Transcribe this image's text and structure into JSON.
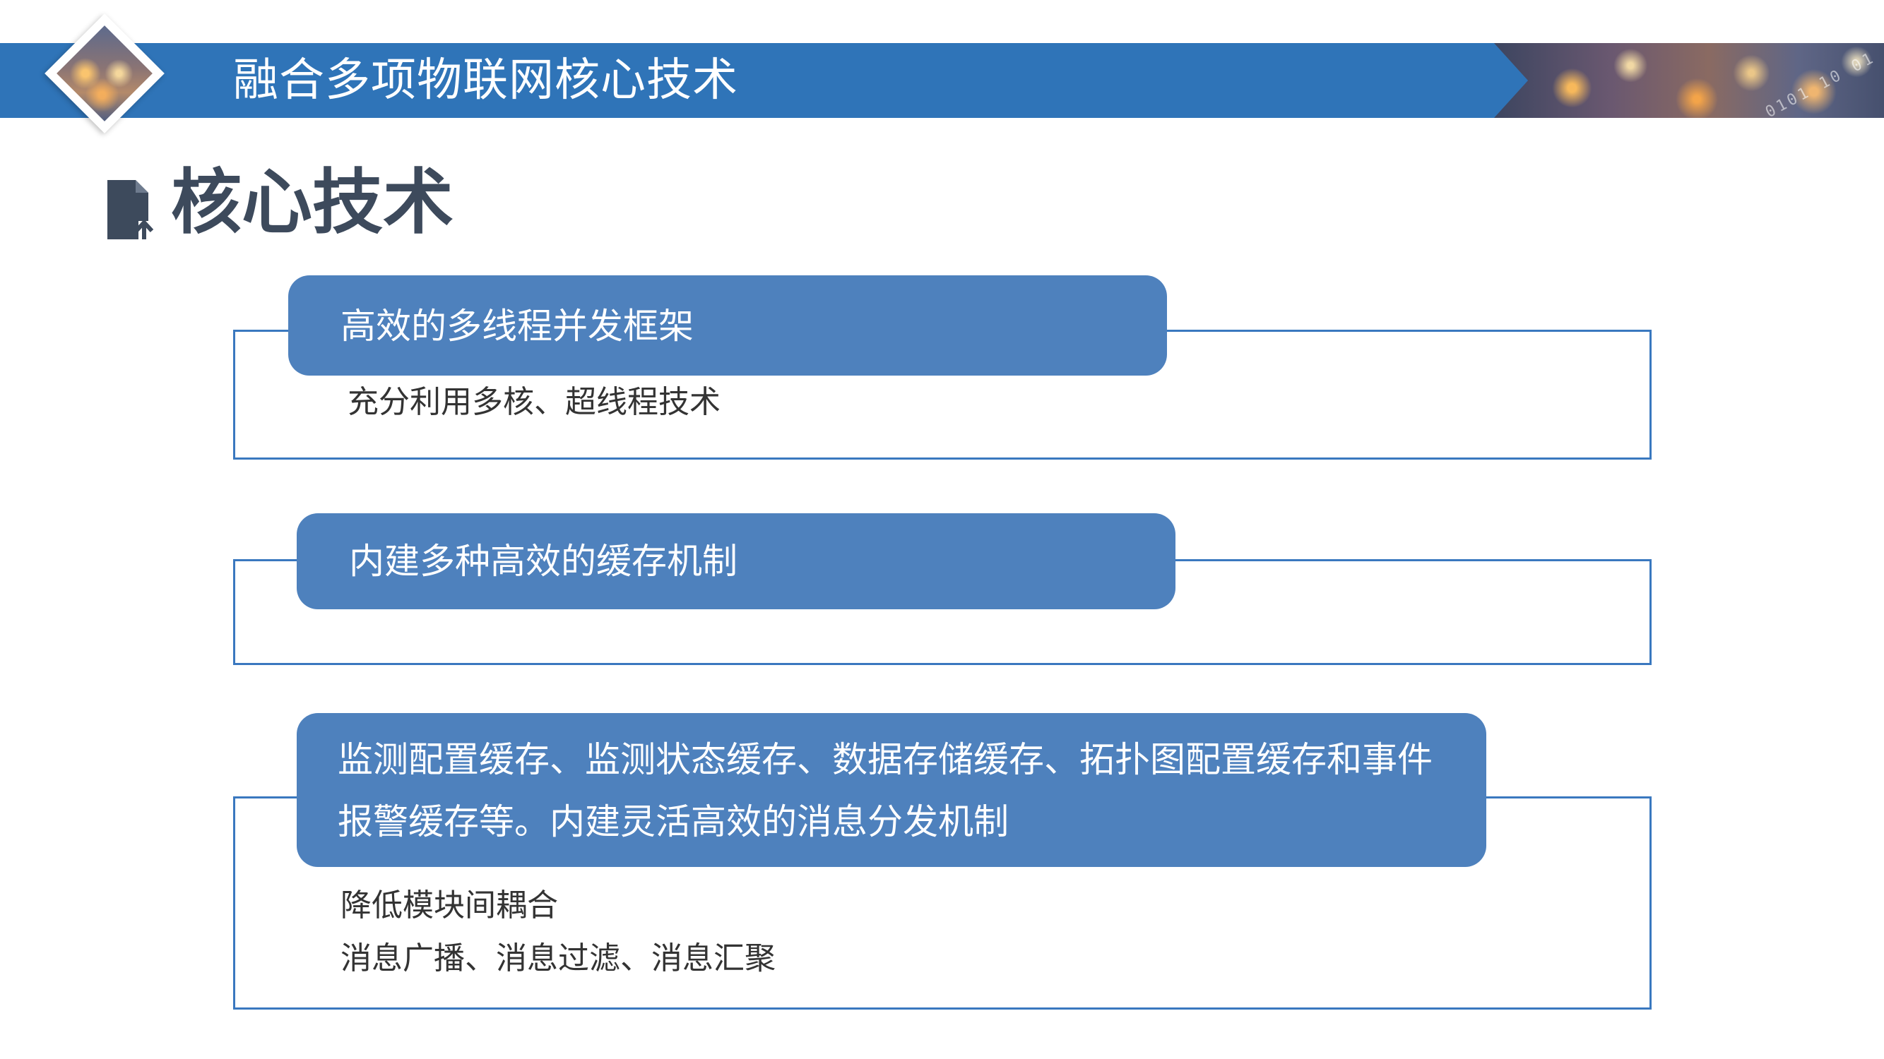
{
  "header": {
    "title": "融合多项物联网核心技术"
  },
  "section": {
    "heading": "核心技术",
    "icon": "document-upload-icon"
  },
  "items": [
    {
      "title": "高效的多线程并发框架",
      "details": [
        "充分利用多核、超线程技术"
      ]
    },
    {
      "title": "内建多种高效的缓存机制",
      "details": []
    },
    {
      "title_lines": [
        "监测配置缓存、监测状态缓存、数据存储缓存、拓扑图配置缓存和事件",
        "报警缓存等。内建灵活高效的消息分发机制"
      ],
      "details": [
        "降低模块间耦合",
        "消息广播、消息过滤、消息汇聚"
      ]
    }
  ],
  "colors": {
    "banner": "#2f74b8",
    "pill": "#4e81bd",
    "border": "#3a78bf",
    "heading": "#3d4a5c"
  }
}
